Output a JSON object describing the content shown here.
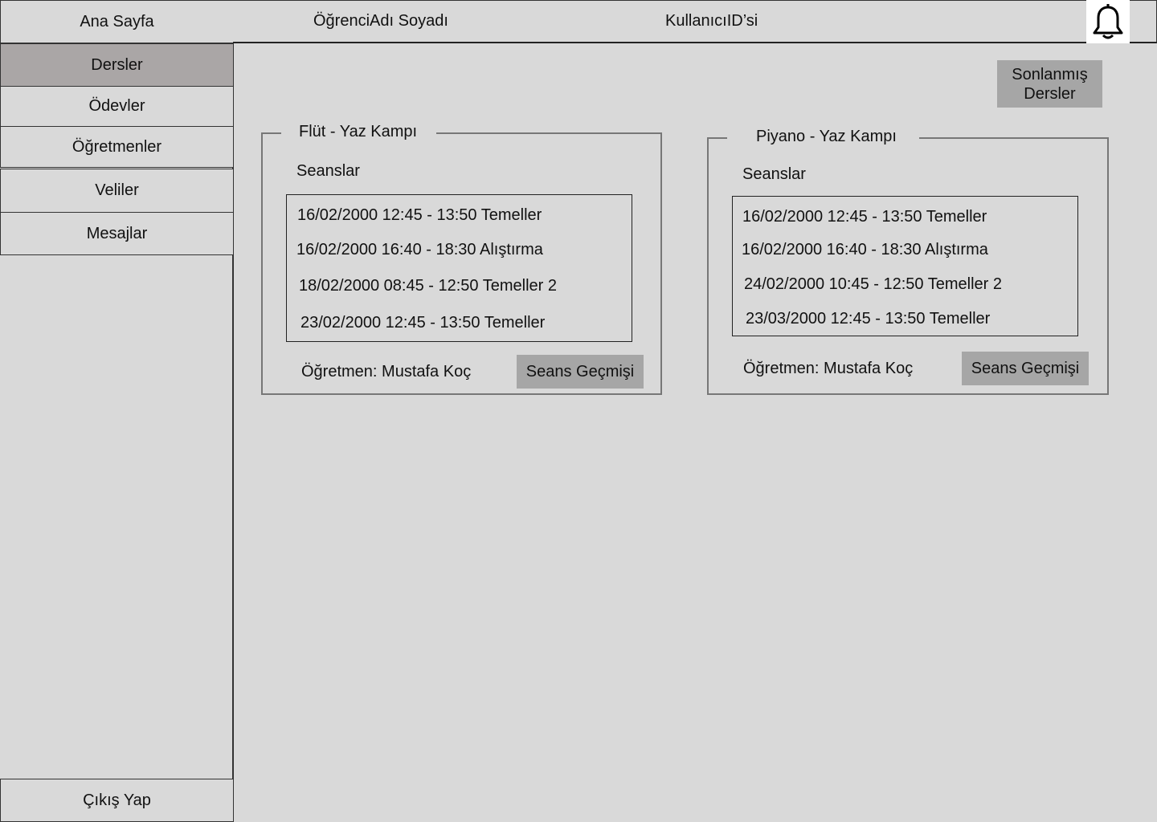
{
  "sidebar": {
    "home": "Ana Sayfa",
    "items": [
      {
        "label": "Dersler",
        "active": true
      },
      {
        "label": "Ödevler"
      },
      {
        "label": "Öğretmenler"
      },
      {
        "label": "Veliler"
      },
      {
        "label": "Mesajlar"
      }
    ],
    "logout": "Çıkış Yap"
  },
  "header": {
    "student_name": "ÖğrenciAdı Soyadı",
    "user_id": "KullanıcıID’si",
    "notification_icon": "bell-icon"
  },
  "main": {
    "finished_courses_button": "Sonlanmış Dersler",
    "courses": [
      {
        "title": "Flüt - Yaz Kampı",
        "sessions_label": "Seanslar",
        "sessions": [
          "16/02/2000 12:45 - 13:50 Temeller",
          "16/02/2000 16:40 - 18:30 Alıştırma",
          "18/02/2000 08:45 - 12:50 Temeller 2",
          "23/02/2000 12:45 - 13:50 Temeller"
        ],
        "teacher": "Öğretmen: Mustafa Koç",
        "history_button": "Seans Geçmişi"
      },
      {
        "title": "Piyano - Yaz Kampı",
        "sessions_label": "Seanslar",
        "sessions": [
          "16/02/2000 12:45 - 13:50 Temeller",
          "16/02/2000 16:40 - 18:30 Alıştırma",
          "24/02/2000 10:45 - 12:50 Temeller 2",
          "23/03/2000 12:45 - 13:50 Temeller"
        ],
        "teacher": "Öğretmen: Mustafa Koç",
        "history_button": "Seans Geçmişi"
      }
    ]
  },
  "colors": {
    "background": "#d9d9d9",
    "active_nav": "#aaa6a6",
    "button": "#a6a6a6"
  }
}
